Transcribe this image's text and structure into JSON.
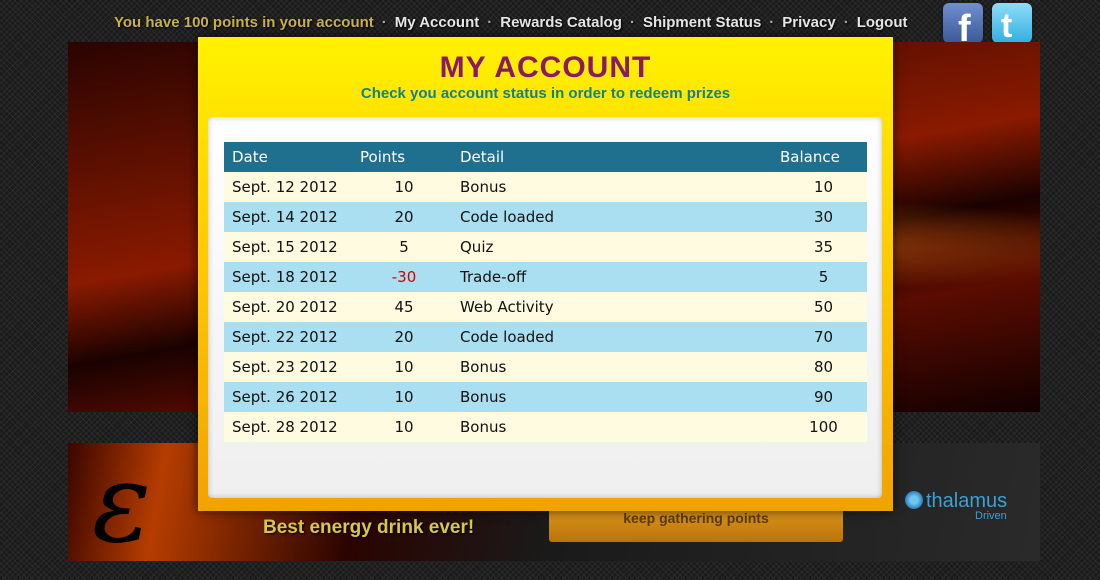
{
  "topnav": {
    "points_message": "You have 100 points in your account",
    "links": [
      "My Account",
      "Rewards Catalog",
      "Shipment Status",
      "Privacy",
      "Logout"
    ],
    "separator": "·"
  },
  "social": {
    "facebook": "facebook-icon",
    "twitter": "twitter-icon"
  },
  "banner": {
    "tagline": "Best energy drink ever!",
    "gather_button": "keep gathering points",
    "partner_name": "thalamus",
    "partner_sub": "Driven"
  },
  "modal": {
    "title": "MY ACCOUNT",
    "subtitle": "Check you account status in order to redeem prizes",
    "columns": [
      "Date",
      "Points",
      "Detail",
      "Balance"
    ],
    "rows": [
      {
        "date": "Sept. 12 2012",
        "points": "10",
        "detail": "Bonus",
        "balance": "10"
      },
      {
        "date": "Sept. 14 2012",
        "points": "20",
        "detail": "Code loaded",
        "balance": "30"
      },
      {
        "date": "Sept. 15 2012",
        "points": "5",
        "detail": "Quiz",
        "balance": "35"
      },
      {
        "date": "Sept. 18 2012",
        "points": "-30",
        "detail": "Trade-off",
        "balance": "5"
      },
      {
        "date": "Sept. 20 2012",
        "points": "45",
        "detail": "Web Activity",
        "balance": "50"
      },
      {
        "date": "Sept. 22 2012",
        "points": "20",
        "detail": "Code loaded",
        "balance": "70"
      },
      {
        "date": "Sept. 23 2012",
        "points": "10",
        "detail": "Bonus",
        "balance": "80"
      },
      {
        "date": "Sept. 26 2012",
        "points": "10",
        "detail": "Bonus",
        "balance": "90"
      },
      {
        "date": "Sept. 28 2012",
        "points": "10",
        "detail": "Bonus",
        "balance": "100"
      }
    ]
  },
  "colors": {
    "title": "#8a1a63",
    "subtitle": "#157f8a",
    "header_row": "#1f6f8f",
    "row_light": "#fffbe0",
    "row_blue": "#a9dff0",
    "negative": "#d00000"
  }
}
